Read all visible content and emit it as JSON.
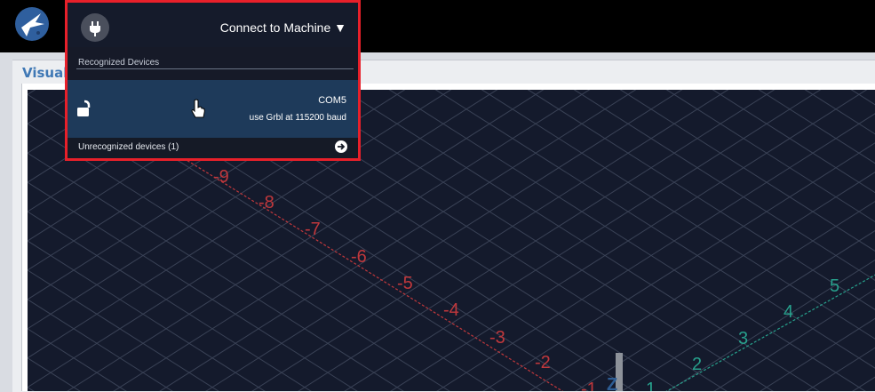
{
  "panel": {
    "title": "Visuali"
  },
  "connect": {
    "title": "Connect to Machine ▼",
    "section_label": "Recognized Devices",
    "device": {
      "port": "COM5",
      "description": "use Grbl at 115200 baud"
    },
    "unrecognized_label": "Unrecognized devices (1)"
  },
  "axes": {
    "x_labels": [
      "-9",
      "-8",
      "-7",
      "-6",
      "-5",
      "-4",
      "-3",
      "-2",
      "-1"
    ],
    "y_labels": [
      "1",
      "2",
      "3",
      "4",
      "5"
    ],
    "z_label": "Z"
  },
  "colors": {
    "x_axis": "#c0383c",
    "y_axis": "#27a08c",
    "grid": "#3a4256",
    "background": "#141a2c",
    "highlight": "#e8202a"
  },
  "icons": {
    "logo": "rocket-logo-icon",
    "plug": "plug-icon",
    "lock": "unlock-icon",
    "cursor": "hand-pointer-icon",
    "next": "arrow-right-circle-icon"
  }
}
